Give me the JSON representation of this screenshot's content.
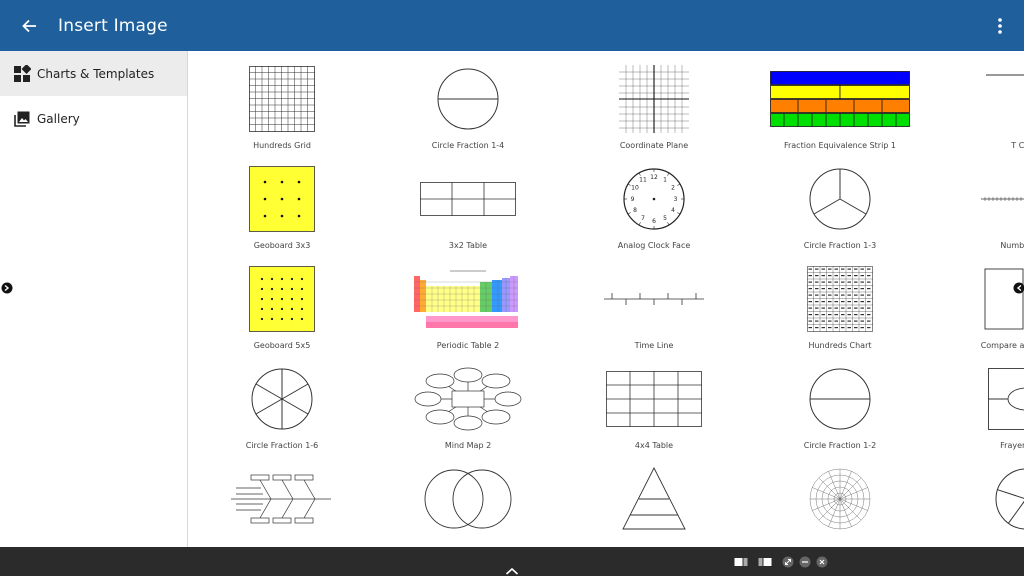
{
  "header": {
    "title": "Insert Image",
    "back_icon": "arrow-left-icon",
    "menu_icon": "more-vertical-icon"
  },
  "sidebar": {
    "items": [
      {
        "label": "Charts & Templates",
        "icon": "dashboard-icon",
        "active": true
      },
      {
        "label": "Gallery",
        "icon": "photo-library-icon",
        "active": false
      }
    ]
  },
  "templates": [
    {
      "label": "Hundreds Grid"
    },
    {
      "label": "Circle Fraction 1-4"
    },
    {
      "label": "Coordinate Plane"
    },
    {
      "label": "Fraction Equivalence Strip 1"
    },
    {
      "label": "T Chart"
    },
    {
      "label": "Geoboard 3x3"
    },
    {
      "label": "3x2 Table"
    },
    {
      "label": "Analog Clock Face"
    },
    {
      "label": "Circle Fraction 1-3"
    },
    {
      "label": "Number Line"
    },
    {
      "label": "Geoboard 5x5"
    },
    {
      "label": "Periodic Table 2"
    },
    {
      "label": "Time Line"
    },
    {
      "label": "Hundreds Chart"
    },
    {
      "label": "Compare and Contrast"
    },
    {
      "label": "Circle Fraction 1-6"
    },
    {
      "label": "Mind Map 2"
    },
    {
      "label": "4x4 Table"
    },
    {
      "label": "Circle Fraction 1-2"
    },
    {
      "label": "Frayer Model"
    },
    {
      "label": ""
    },
    {
      "label": ""
    },
    {
      "label": ""
    },
    {
      "label": ""
    },
    {
      "label": ""
    }
  ],
  "colors": {
    "header_bg": "#1e5f9c",
    "active_item_bg": "#ececec",
    "taskbar_bg": "#2b2b2b",
    "geoboard_yellow": "#ffff33",
    "strip_blue": "#0000ff",
    "strip_yellow": "#ffff00",
    "strip_orange": "#ff8000",
    "strip_green": "#00e000"
  },
  "taskbar": {
    "launcher_icon": "chevron-up-icon",
    "tray_icons": [
      "window-layout-icon",
      "window-layout-icon",
      "fullscreen-icon",
      "minimize-icon",
      "close-icon"
    ]
  }
}
